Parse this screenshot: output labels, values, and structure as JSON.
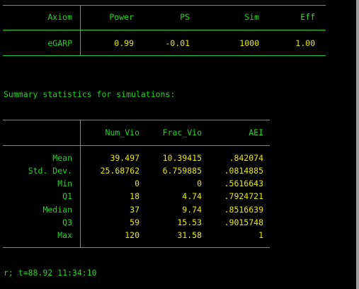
{
  "colors": {
    "background": "#000000",
    "text": "#22d322",
    "result": "#e8e800",
    "rule": "#22c822",
    "scrollbar": "#9e9e9e"
  },
  "test_table": {
    "headers": [
      "Axiom",
      "Power",
      "PS",
      "Sim",
      "Eff"
    ],
    "row": [
      "eGARP",
      "0.99",
      "-0.01",
      "1000",
      "1.00"
    ]
  },
  "summary_heading": "Summary statistics for simulations:",
  "summary_table": {
    "headers": [
      "Num_Vio",
      "Frac_Vio",
      "AEI"
    ],
    "rows": [
      {
        "label": "Mean",
        "values": [
          "39.497",
          "10.39415",
          ".842074"
        ]
      },
      {
        "label": "Std. Dev.",
        "values": [
          "25.68762",
          "6.759885",
          ".0814885"
        ]
      },
      {
        "label": "Min",
        "values": [
          "0",
          "0",
          ".5616643"
        ]
      },
      {
        "label": "Q1",
        "values": [
          "18",
          "4.74",
          ".7924721"
        ]
      },
      {
        "label": "Median",
        "values": [
          "37",
          "9.74",
          ".8516639"
        ]
      },
      {
        "label": "Q3",
        "values": [
          "59",
          "15.53",
          ".9015748"
        ]
      },
      {
        "label": "Max",
        "values": [
          "120",
          "31.58",
          "1"
        ]
      }
    ]
  },
  "status_line": "r; t=88.92 11:34:10"
}
